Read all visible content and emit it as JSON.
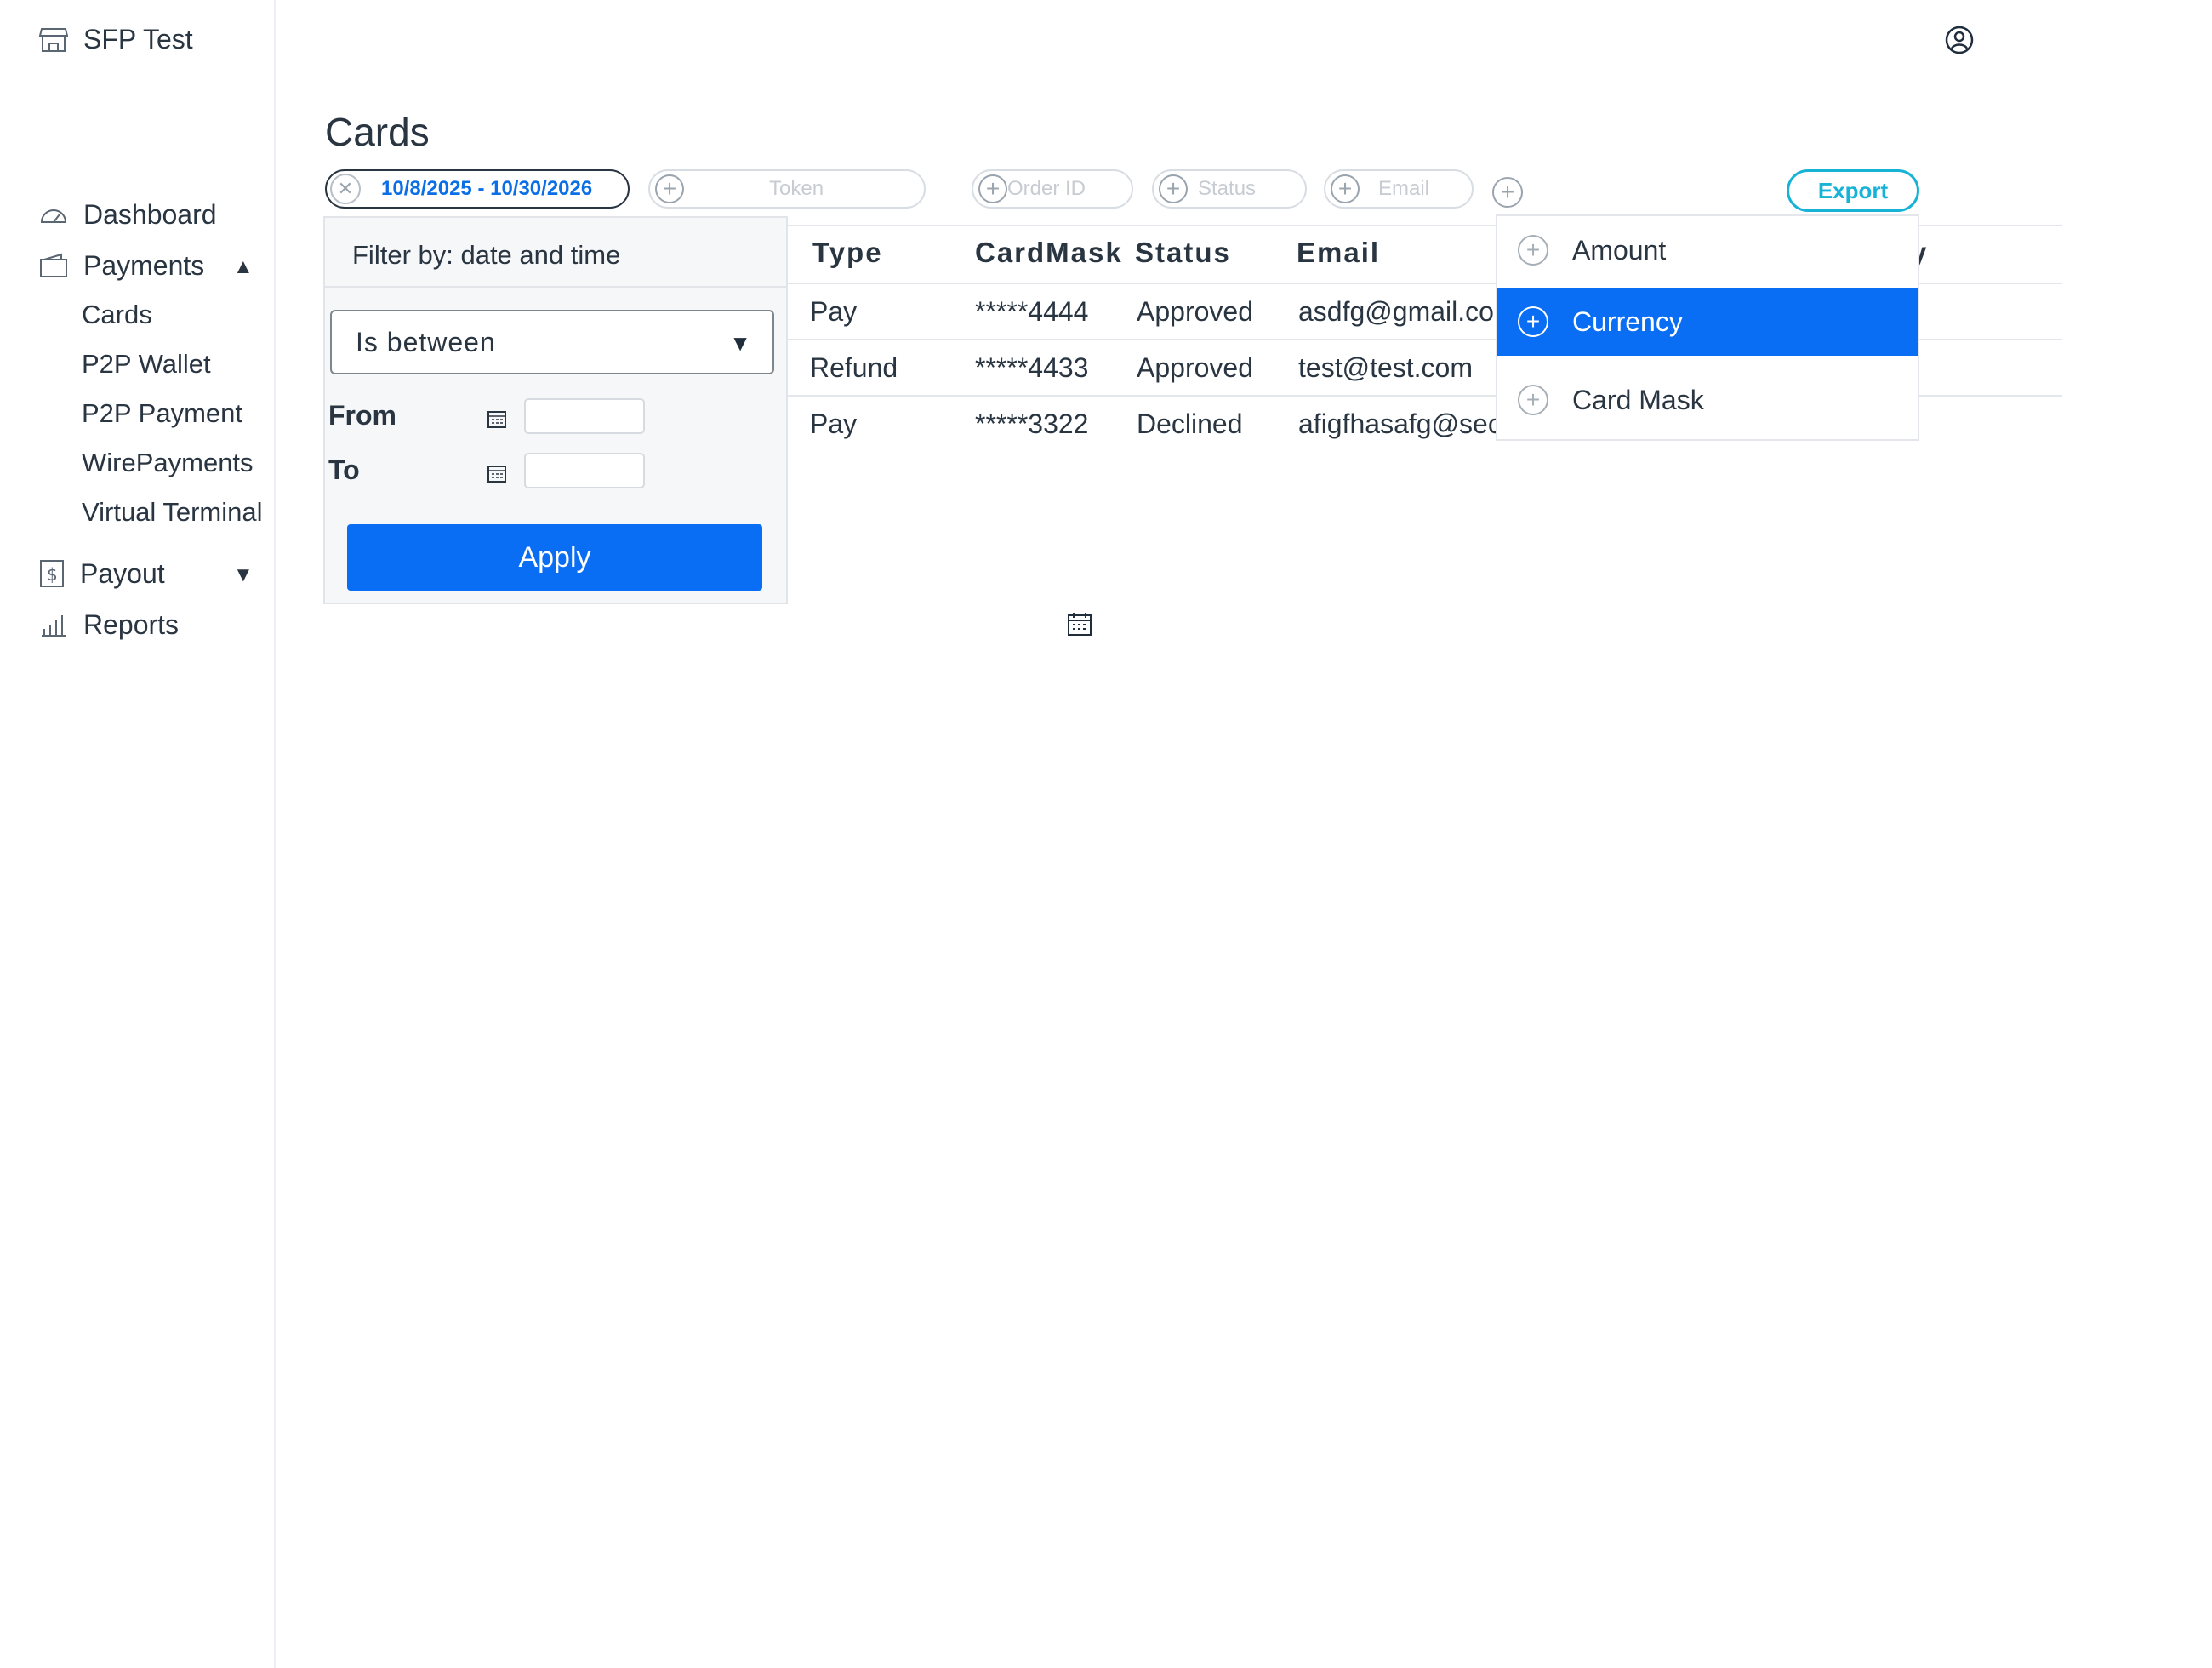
{
  "app": {
    "name": "SFP Test"
  },
  "sidebar": {
    "items": [
      {
        "label": "Dashboard",
        "icon": "dashboard-icon"
      },
      {
        "label": "Payments",
        "icon": "wallet-icon",
        "expanded": true
      },
      {
        "label": "Payout",
        "icon": "dollar-document-icon",
        "expanded": false
      },
      {
        "label": "Reports",
        "icon": "bar-chart-icon"
      }
    ],
    "payments_sub": [
      "Cards",
      "P2P Wallet",
      "P2P Payment",
      "WirePayments",
      "Virtual Terminal"
    ]
  },
  "page": {
    "title": "Cards"
  },
  "filters": {
    "date_range": "10/8/2025 -  10/30/2026",
    "token": "Token",
    "order_id": "Order ID",
    "status": "Status",
    "email": "Email",
    "export": "Export"
  },
  "table": {
    "headers": [
      "Type",
      "CardMask",
      "Status",
      "Email"
    ],
    "rows": [
      [
        "Pay",
        "*****4444",
        "Approved",
        "asdfg@gmail.co"
      ],
      [
        "Refund",
        "*****4433",
        "Approved",
        "test@test.com"
      ],
      [
        "Pay",
        "*****3322",
        "Declined",
        "afigfhasafg@sec"
      ]
    ],
    "partial_header_char": "y"
  },
  "date_filter": {
    "heading": "Filter by: date and time",
    "operator": "Is between",
    "from_label": "From",
    "to_label": "To",
    "apply": "Apply"
  },
  "column_menu": {
    "items": [
      "Amount",
      "Currency",
      "Card Mask"
    ],
    "highlighted": "Currency"
  },
  "colors": {
    "accent": "#0a6ef5",
    "export": "#17b3d6",
    "text": "#2a3542"
  }
}
